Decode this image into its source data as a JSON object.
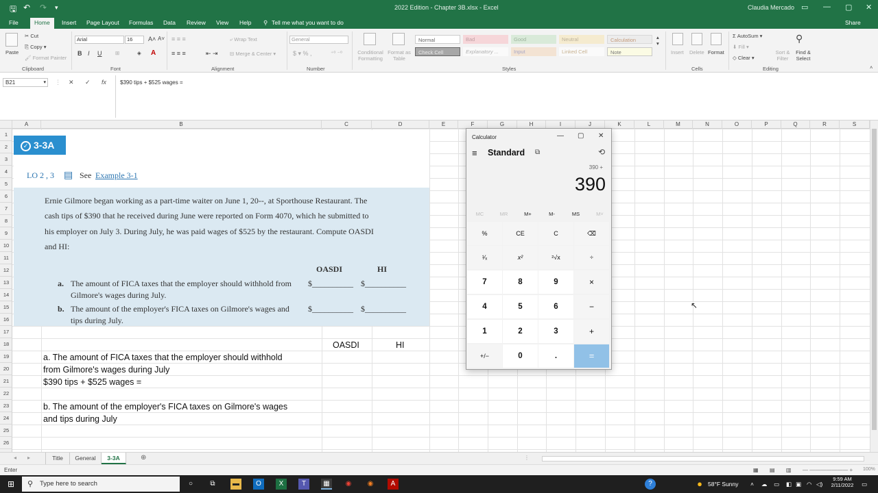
{
  "window": {
    "title": "2022 Edition - Chapter 3B.xlsx - Excel",
    "user": "Claudia Mercado",
    "share": "Share"
  },
  "menu": {
    "tabs": [
      "File",
      "Home",
      "Insert",
      "Page Layout",
      "Formulas",
      "Data",
      "Review",
      "View",
      "Help"
    ],
    "tell_me": "Tell me what you want to do"
  },
  "ribbon": {
    "clipboard": {
      "paste": "Paste",
      "cut": "Cut",
      "copy": "Copy",
      "format_painter": "Format Painter",
      "label": "Clipboard"
    },
    "font": {
      "name": "Arial",
      "size": "16",
      "label": "Font"
    },
    "alignment": {
      "wrap": "Wrap Text",
      "merge": "Merge & Center",
      "label": "Alignment"
    },
    "number": {
      "format": "General",
      "label": "Number"
    },
    "styles": {
      "conditional": "Conditional Formatting",
      "format_as_table": "Format as Table",
      "cells": [
        "Normal",
        "Bad",
        "Good",
        "Neutral",
        "Calculation",
        "Check Cell",
        "Explanatory ...",
        "Input",
        "Linked Cell",
        "Note"
      ],
      "label": "Styles"
    },
    "cells": {
      "insert": "Insert",
      "delete": "Delete",
      "format": "Format",
      "label": "Cells"
    },
    "editing": {
      "autosum": "AutoSum",
      "fill": "Fill",
      "clear": "Clear",
      "sort": "Sort & Filter",
      "find": "Find & Select",
      "label": "Editing"
    }
  },
  "formula_bar": {
    "name_box": "B21",
    "content": "$390 tips + $525 wages ="
  },
  "grid": {
    "columns": [
      "A",
      "B",
      "C",
      "D",
      "E",
      "F",
      "G",
      "H",
      "I",
      "J",
      "K",
      "L",
      "M",
      "N",
      "O",
      "P",
      "Q",
      "R",
      "S"
    ],
    "rows": [
      "1",
      "2",
      "3",
      "4",
      "5",
      "6",
      "7",
      "8",
      "9",
      "10",
      "11",
      "12",
      "13",
      "14",
      "15",
      "16",
      "17",
      "18",
      "19",
      "20",
      "21",
      "22",
      "23",
      "24",
      "25",
      "26"
    ]
  },
  "textbook": {
    "badge": "3-3A",
    "lo": "LO 2 , 3",
    "see": "See",
    "example": "Example 3-1",
    "para_lines": [
      "Ernie Gilmore began working as a part-time waiter on June 1, 20--, at Sporthouse Restaurant. The",
      "cash tips of $390 that he received during June were reported on Form 4070, which he submitted to",
      "his employer on July 3. During July, he was paid wages of $525 by the restaurant. Compute OASDI",
      "and HI:"
    ],
    "col_oasdi": "OASDI",
    "col_hi": "HI",
    "qa_letter": "a.",
    "qa_lines": [
      "The amount of FICA taxes that the employer should withhold from",
      "Gilmore's wages during July."
    ],
    "qb_letter": "b.",
    "qb_lines": [
      "The amount of the employer's FICA taxes on Gilmore's wages and",
      "tips during July."
    ],
    "blank": "$__________"
  },
  "sheet": {
    "c18": "OASDI",
    "d18": "HI",
    "b19": "a. The amount of FICA taxes that the employer should withhold",
    "b20": "from Gilmore's wages during July",
    "b21": "$390 tips + $525 wages =",
    "b23": "b. The amount of the employer's FICA taxes on Gilmore's wages",
    "b24": "and tips during July"
  },
  "sheet_tabs": [
    "Title",
    "General",
    "3-3A"
  ],
  "active_sheet": "3-3A",
  "status": {
    "mode": "Enter",
    "zoom": "100%"
  },
  "calculator": {
    "title": "Calculator",
    "mode": "Standard",
    "expression": "390 +",
    "display": "390",
    "memory": [
      "MC",
      "MR",
      "M+",
      "M-",
      "MS",
      "M˅"
    ],
    "keys": [
      [
        "%",
        "CE",
        "C",
        "⌫"
      ],
      [
        "¹⁄ₓ",
        "x²",
        "²√x",
        "÷"
      ],
      [
        "7",
        "8",
        "9",
        "×"
      ],
      [
        "4",
        "5",
        "6",
        "−"
      ],
      [
        "1",
        "2",
        "3",
        "+"
      ],
      [
        "+/−",
        "0",
        ".",
        "="
      ]
    ]
  },
  "taskbar": {
    "search_placeholder": "Type here to search",
    "weather": "58°F  Sunny",
    "time": "9:59 AM",
    "date": "2/11/2022"
  },
  "colors": {
    "excel_green": "#217346",
    "badge_blue": "#2a8fcf",
    "textbook_bg": "#dbe9f2",
    "equals_key": "#91c1e7"
  }
}
